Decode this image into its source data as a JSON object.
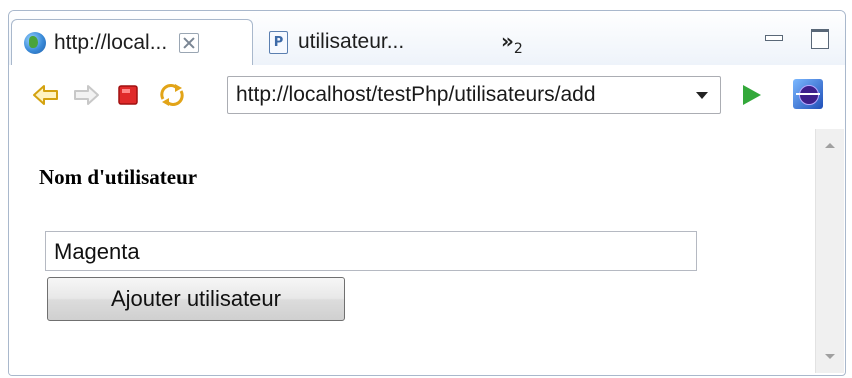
{
  "tabs": [
    {
      "label": "http://local...",
      "icon": "globe-icon",
      "active": true
    },
    {
      "label": "utilisateur...",
      "icon": "php-file-icon",
      "active": false
    }
  ],
  "tab_overflow": {
    "symbol": "»",
    "count": "2"
  },
  "toolbar": {
    "url": "http://localhost/testPhp/utilisateurs/add"
  },
  "form": {
    "label": "Nom d'utilisateur",
    "input_value": "Magenta",
    "submit_label": "Ajouter utilisateur"
  },
  "colors": {
    "back_arrow": "#e8b820",
    "stop": "#e02a2a",
    "go": "#33a83a",
    "border": "#a9b8cc"
  }
}
